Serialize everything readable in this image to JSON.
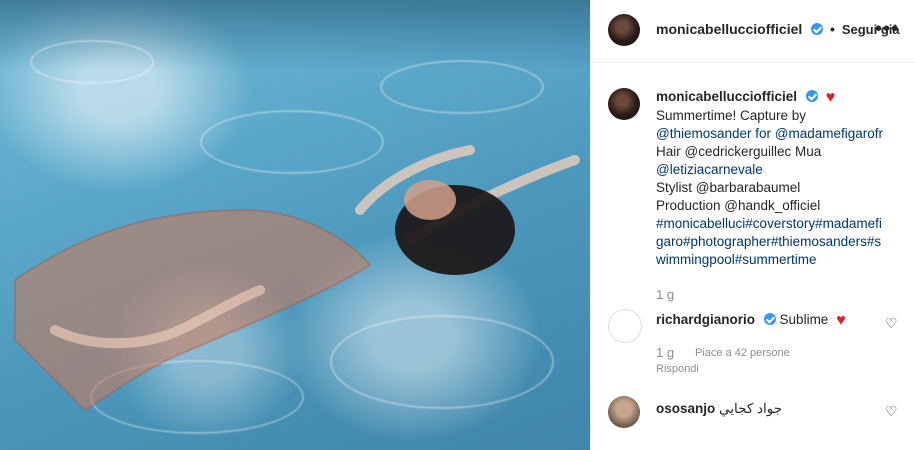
{
  "post": {
    "header": {
      "username": "monicabellucciofficiel",
      "follow_label": "Segui già",
      "more_icon": "more-icon"
    },
    "caption": {
      "username": "monicabellucciofficiel",
      "text_lines": [
        "Summertime! Capture by",
        "@thiemosander for @madamefigarofr",
        "Hair @cedrickerguillec Mua",
        "@letiziacarnevale",
        "Stylist @barbarabaumel",
        "Production @handk_officiel",
        "#monicabelluci#coverstory#madamefi",
        "garo#photographer#thiemosanders#s",
        "wimmingpool#summertime"
      ],
      "time": "1 g"
    },
    "comments": [
      {
        "username": "richardgianorio",
        "text": "Sublime",
        "time": "1 g",
        "likes_text": "Piace a 42 persone",
        "reply_label": "Rispondi"
      },
      {
        "username": "ososanjo",
        "text": "جواد كجايي"
      }
    ]
  },
  "colors": {
    "verified": "#3897f0",
    "heart": "#e01e2a",
    "link": "#00376b",
    "muted": "#8e8e8e"
  }
}
